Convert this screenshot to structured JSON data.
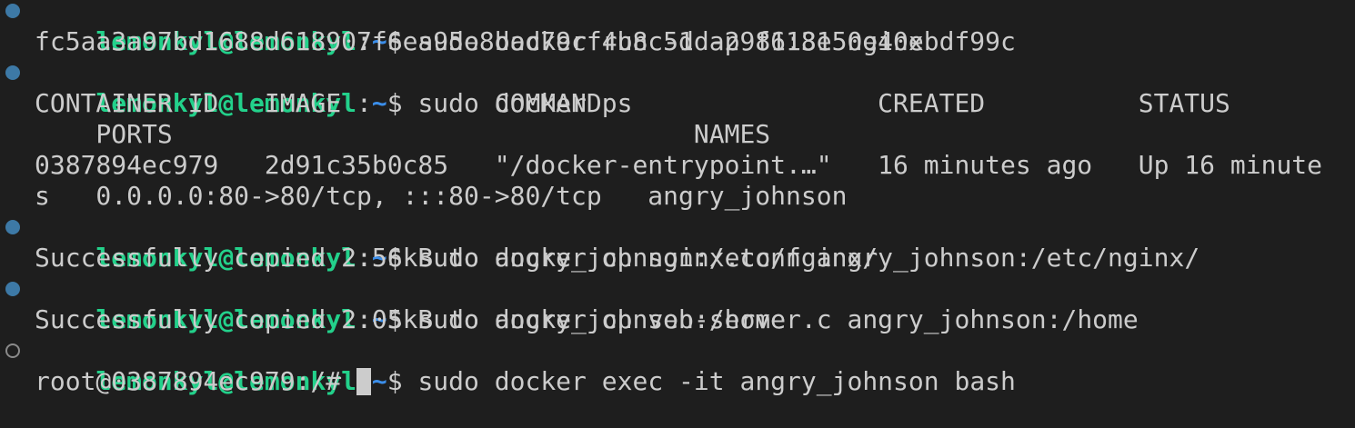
{
  "colors": {
    "background": "#1e1e1e",
    "foreground": "#cccccc",
    "prompt_user": "#23d18b",
    "prompt_path": "#3b8eea",
    "decoration_success": "#3d79a6",
    "decoration_pending": "#8a8a8a"
  },
  "icons": {
    "success_decoration": "filled-circle",
    "pending_decoration": "hollow-circle"
  },
  "prompt": {
    "user_host": "lemonkyl@lemonkyl",
    "colon": ":",
    "path": "~",
    "symbol": "$ "
  },
  "commands": [
    "sudo docker run -d -p 81:81 nginx",
    "sudo docker ps",
    "sudo docker cp nginx.conf angry_johnson:/etc/nginx/",
    "sudo docker cp veb-server.c angry_johnson:/home",
    "sudo docker exec -it angry_johnson bash"
  ],
  "outputs": {
    "container_hash": "fc5aa3a97bd1688d618907f6ea95e8bad79cf4b8c51da29f613e50e40ebdf99c",
    "ps_header_1": "CONTAINER ID   IMAGE          COMMAND                  CREATED          STATUS",
    "ps_header_2": "    PORTS                                  NAMES",
    "ps_row_1": "0387894ec979   2d91c35b0c85   \"/docker-entrypoint.…\"   16 minutes ago   Up 16 minute",
    "ps_row_2": "s   0.0.0.0:80->80/tcp, :::80->80/tcp   angry_johnson",
    "copy_1": "Successfully copied 2.56kB to angry_johnson:/etc/nginx/",
    "copy_2": "Successfully copied 2.05kB to angry_johnson:/home",
    "root_prompt": "root@0387894ec979:/# "
  }
}
